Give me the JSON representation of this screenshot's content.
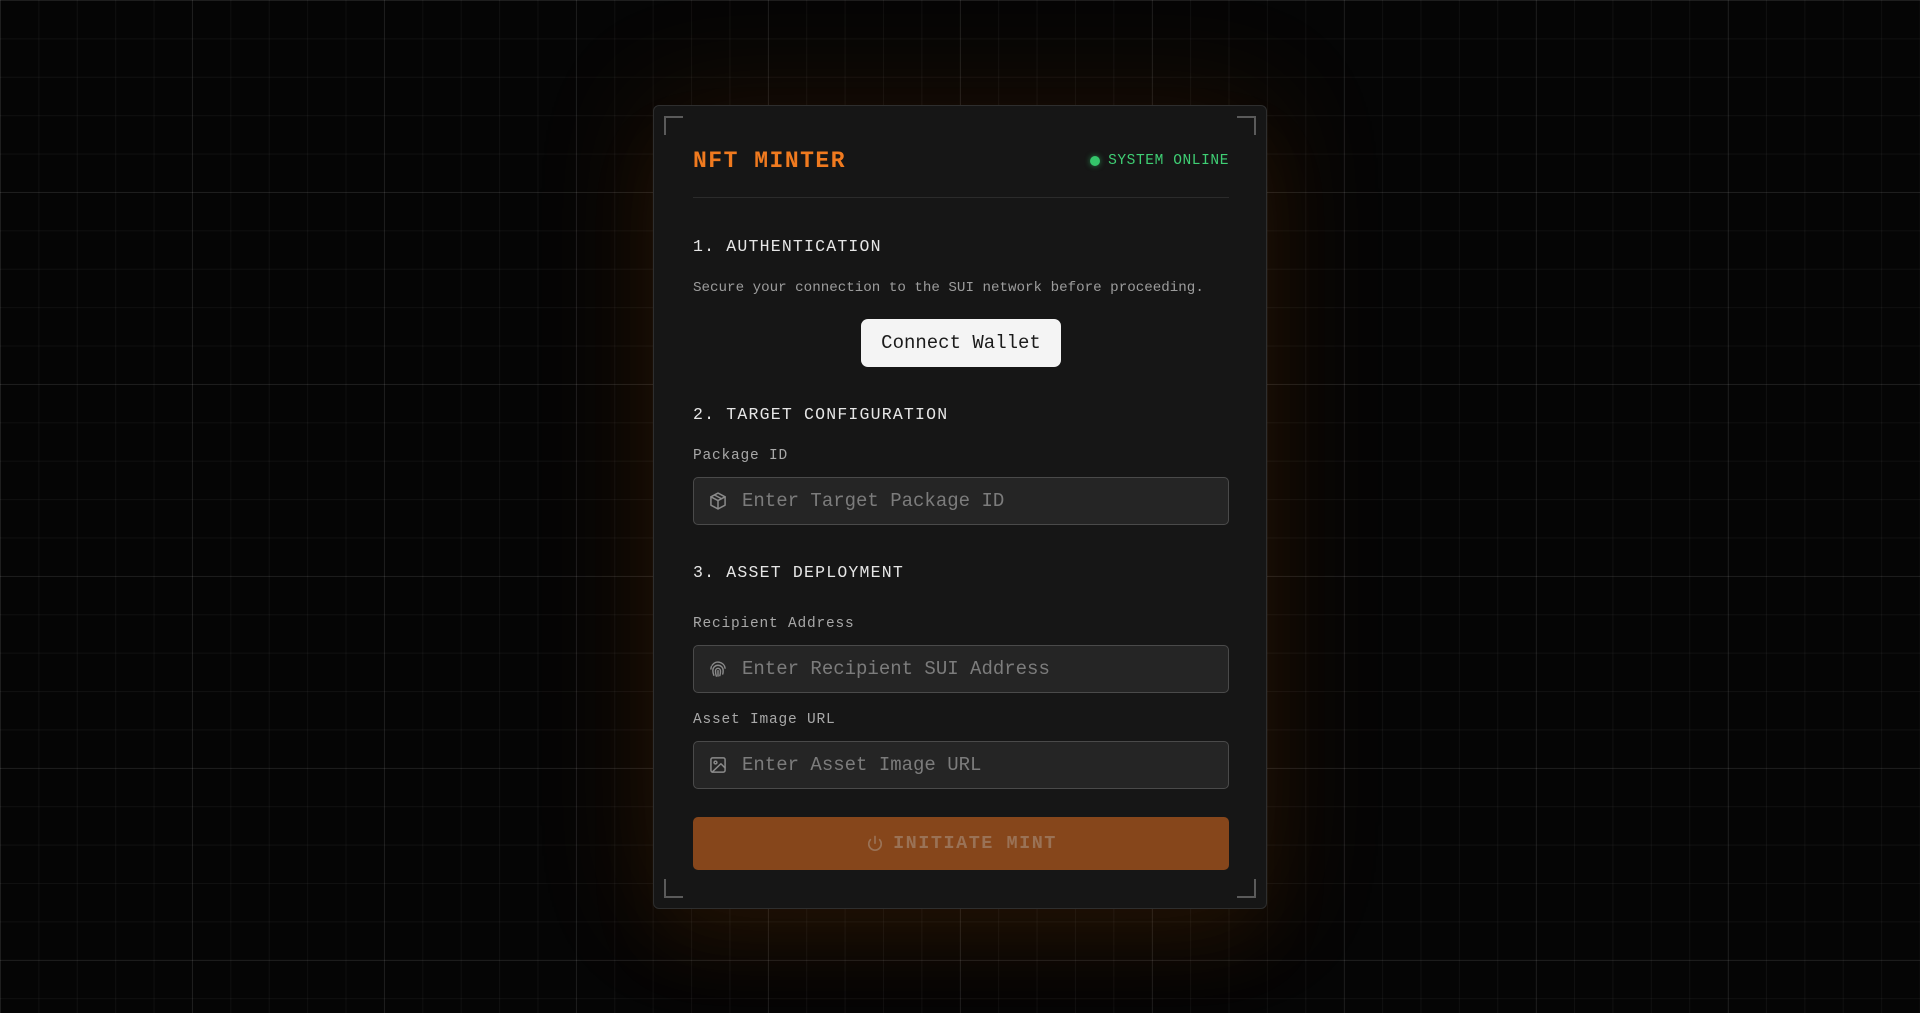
{
  "header": {
    "title": "NFT MINTER",
    "status": "SYSTEM ONLINE"
  },
  "auth": {
    "heading": "1. AUTHENTICATION",
    "description": "Secure your connection to the SUI network before proceeding.",
    "connect_label": "Connect Wallet"
  },
  "target": {
    "heading": "2. TARGET CONFIGURATION",
    "package_label": "Package ID",
    "package_placeholder": "Enter Target Package ID",
    "package_icon": "package-icon"
  },
  "deploy": {
    "heading": "3. ASSET DEPLOYMENT",
    "recipient_label": "Recipient Address",
    "recipient_placeholder": "Enter Recipient SUI Address",
    "recipient_icon": "fingerprint-icon",
    "image_label": "Asset Image URL",
    "image_placeholder": "Enter Asset Image URL",
    "image_icon": "image-icon",
    "mint_label": "INITIATE MINT",
    "mint_icon": "power-icon"
  },
  "colors": {
    "accent": "#f07a1f",
    "status": "#34c56a",
    "mint_button": "#86461b",
    "card": "#161616",
    "background": "#050505"
  }
}
